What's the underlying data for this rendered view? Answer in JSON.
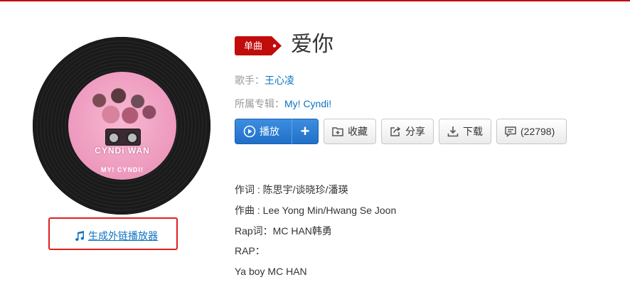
{
  "song": {
    "badge": "单曲",
    "title": "爱你",
    "singer_label": "歌手：",
    "singer": "王心凌",
    "album_label": "所属专辑：",
    "album": "My! Cyndi!"
  },
  "cover": {
    "brand": "CYNDi WAN",
    "album_title": "MY! CYNDI!"
  },
  "external_player": {
    "label": "生成外链播放器"
  },
  "actions": {
    "play": "播放",
    "add": "+",
    "favorite": "收藏",
    "share": "分享",
    "download": "下载",
    "comments": "(22798)"
  },
  "credits": [
    "作词 : 陈思宇/谈晓珍/潘瑛",
    "作曲 : Lee Yong Min/Hwang Se Joon",
    "Rap词：MC HAN韩勇",
    "RAP：",
    "Ya boy MC HAN"
  ],
  "colors": {
    "accent_red": "#c20c0c",
    "link_blue": "#0c73c2",
    "play_blue": "#2a7bd4"
  }
}
